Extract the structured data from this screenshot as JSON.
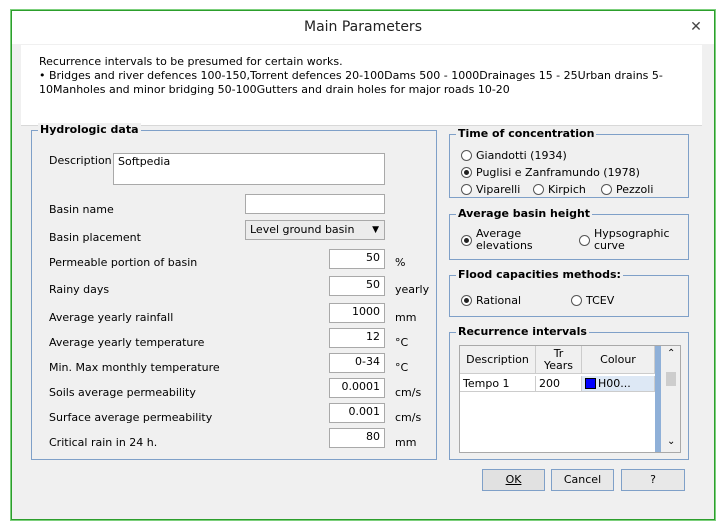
{
  "window": {
    "title": "Main Parameters"
  },
  "info": {
    "line1": "Recurrence intervals to be presumed for certain works.",
    "line2": "• Bridges and river defences 100-150,Torrent defences 20-100Dams 500 - 1000Drainages 15 - 25Urban drains 5-10Manholes and minor bridging 50-100Gutters and drain holes for major roads 10-20"
  },
  "hydro": {
    "title": "Hydrologic data",
    "description_label": "Description",
    "description_value": "Softpedia",
    "basin_name_label": "Basin name",
    "basin_name_value": "",
    "placement_label": "Basin placement",
    "placement_value": "Level ground basin",
    "rows": [
      {
        "label": "Permeable portion of basin",
        "value": "50",
        "unit": "%"
      },
      {
        "label": "Rainy days",
        "value": "50",
        "unit": "yearly"
      },
      {
        "label": "Average yearly rainfall",
        "value": "1000",
        "unit": "mm"
      },
      {
        "label": "Average yearly temperature",
        "value": "12",
        "unit": "°C"
      },
      {
        "label": "Min. Max monthly temperature",
        "value": "0-34",
        "unit": "°C"
      },
      {
        "label": "Soils average permeability",
        "value": "0.0001",
        "unit": "cm/s"
      },
      {
        "label": "Surface average permeability",
        "value": "0.001",
        "unit": "cm/s"
      },
      {
        "label": "Critical rain in 24 h.",
        "value": "80",
        "unit": "mm"
      }
    ]
  },
  "toc": {
    "title": "Time of concentration",
    "options": [
      "Giandotti (1934)",
      "Puglisi e Zanframundo (1978)",
      "Viparelli",
      "Kirpich",
      "Pezzoli"
    ],
    "selected": "Puglisi e Zanframundo (1978)"
  },
  "abh": {
    "title": "Average basin height",
    "options": [
      "Average elevations",
      "Hypsographic curve"
    ],
    "selected": "Average elevations"
  },
  "flood": {
    "title": "Flood capacities methods:",
    "options": [
      "Rational",
      "TCEV"
    ],
    "selected": "Rational"
  },
  "rec": {
    "title": "Recurrence intervals",
    "columns": [
      "Description",
      "Tr Years",
      "Colour"
    ],
    "rows": [
      {
        "description": "Tempo 1",
        "years": "200",
        "colour": "H00...",
        "swatch": "#0000ff"
      }
    ]
  },
  "buttons": {
    "ok": "OK",
    "cancel": "Cancel",
    "help": "?"
  },
  "colors": {
    "frame": "#2c9e2c",
    "group_border": "#7fa0c8"
  }
}
